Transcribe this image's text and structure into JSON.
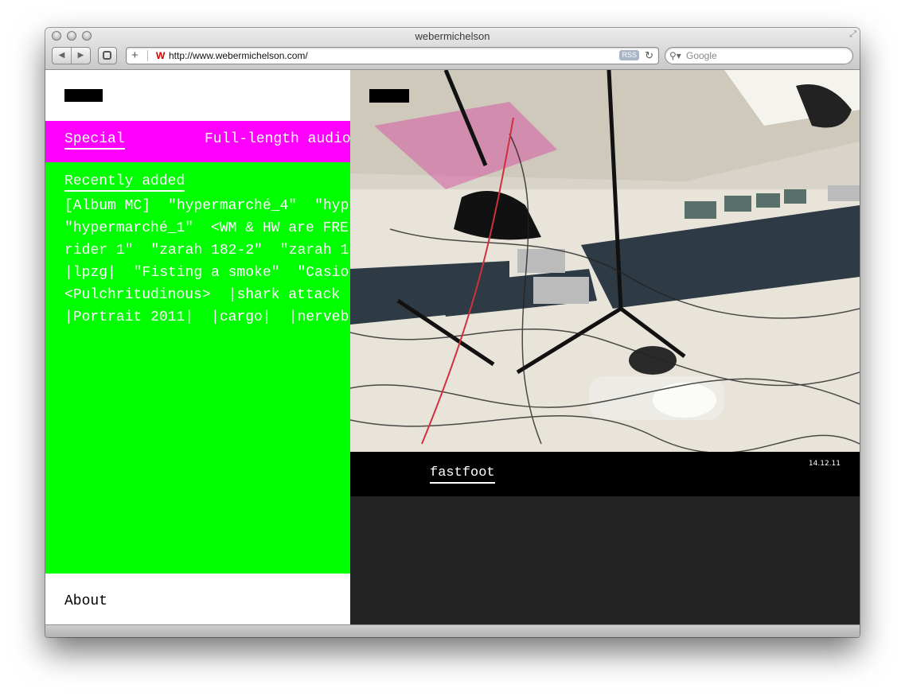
{
  "window": {
    "title": "webermichelson",
    "url": "http://www.webermichelson.com/",
    "rss_label": "RSS",
    "search_placeholder": "Google"
  },
  "sidebar": {
    "special_link": "Special",
    "special_text": "Full-length audio",
    "recent_link": "Recently added",
    "recent_lines": [
      [
        "[Album MC]",
        "\"hypermarché_4\"",
        "\"hyp"
      ],
      [
        "\"hypermarché_1\"",
        "<WM & HW are FRE"
      ],
      [
        "rider 1\"",
        "\"zarah 182-2\"",
        "\"zarah 1"
      ],
      [
        "|lpzg|",
        "\"Fisting a smoke\"",
        "\"Casio"
      ],
      [
        "<Pulchritudinous>",
        "|shark attack"
      ],
      [
        "|Portrait 2011|",
        "|cargo|",
        "|nerveb"
      ]
    ],
    "about": "About"
  },
  "feature": {
    "caption": "fastfoot",
    "date": "14.12.11"
  }
}
